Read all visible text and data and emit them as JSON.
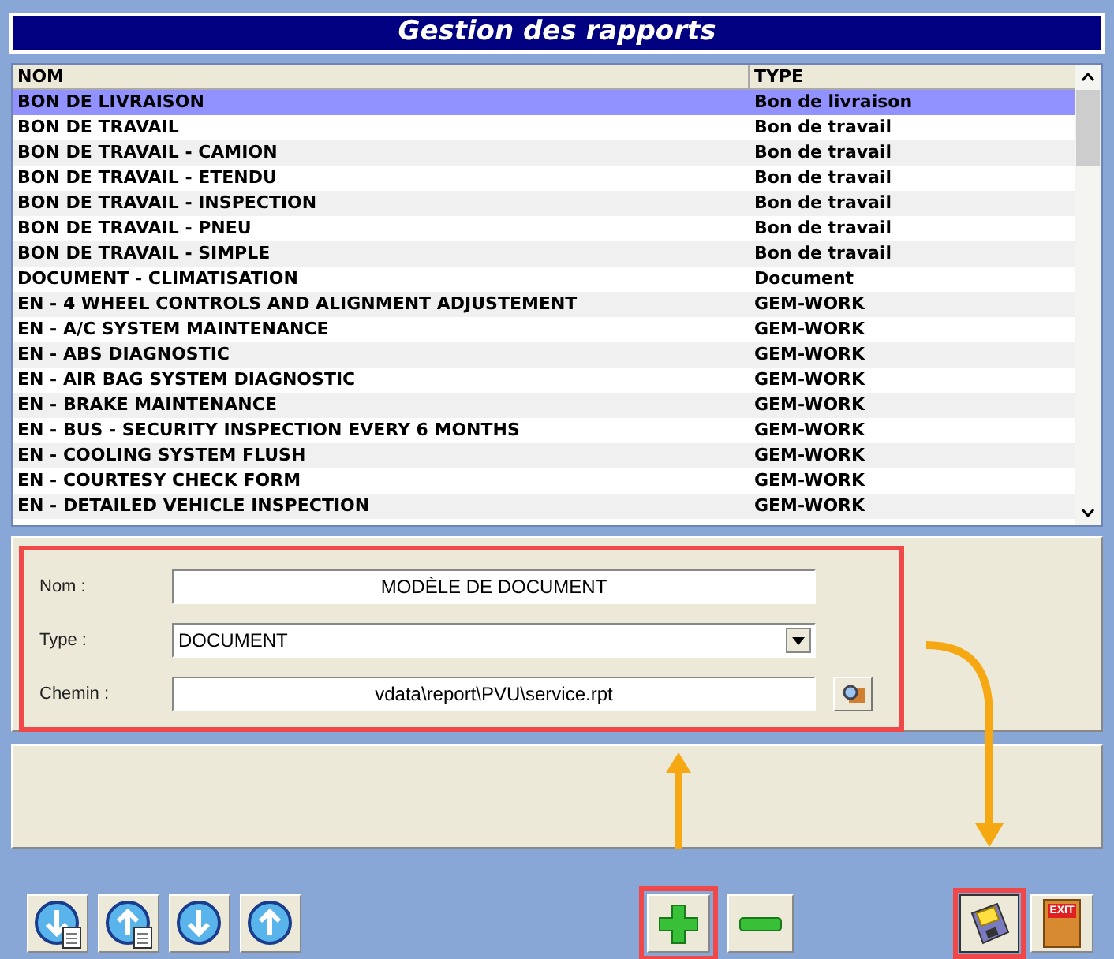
{
  "title": "Gestion des rapports",
  "table": {
    "columns": [
      "NOM",
      "TYPE"
    ],
    "rows": [
      {
        "nom": "BON DE LIVRAISON",
        "type": "Bon de livraison",
        "selected": true
      },
      {
        "nom": "BON DE TRAVAIL",
        "type": "Bon de travail",
        "selected": false
      },
      {
        "nom": "BON DE TRAVAIL - CAMION",
        "type": "Bon de travail",
        "selected": false
      },
      {
        "nom": "BON DE TRAVAIL - ETENDU",
        "type": "Bon de travail",
        "selected": false
      },
      {
        "nom": "BON DE TRAVAIL - INSPECTION",
        "type": "Bon de travail",
        "selected": false
      },
      {
        "nom": "BON DE TRAVAIL - PNEU",
        "type": "Bon de travail",
        "selected": false
      },
      {
        "nom": "BON DE TRAVAIL - SIMPLE",
        "type": "Bon de travail",
        "selected": false
      },
      {
        "nom": "DOCUMENT - CLIMATISATION",
        "type": "Document",
        "selected": false
      },
      {
        "nom": "EN - 4 WHEEL CONTROLS AND ALIGNMENT ADJUSTEMENT",
        "type": "GEM-WORK",
        "selected": false
      },
      {
        "nom": "EN - A/C SYSTEM MAINTENANCE",
        "type": "GEM-WORK",
        "selected": false
      },
      {
        "nom": "EN - ABS DIAGNOSTIC",
        "type": "GEM-WORK",
        "selected": false
      },
      {
        "nom": "EN - AIR BAG SYSTEM DIAGNOSTIC",
        "type": "GEM-WORK",
        "selected": false
      },
      {
        "nom": "EN - BRAKE MAINTENANCE",
        "type": "GEM-WORK",
        "selected": false
      },
      {
        "nom": "EN - BUS - SECURITY INSPECTION EVERY 6 MONTHS",
        "type": "GEM-WORK",
        "selected": false
      },
      {
        "nom": "EN - COOLING SYSTEM FLUSH",
        "type": "GEM-WORK",
        "selected": false
      },
      {
        "nom": "EN - COURTESY CHECK FORM",
        "type": "GEM-WORK",
        "selected": false
      },
      {
        "nom": "EN - DETAILED VEHICLE INSPECTION",
        "type": "GEM-WORK",
        "selected": false
      }
    ]
  },
  "form": {
    "fields": [
      {
        "label": "Nom :",
        "value": "MODÈLE DE DOCUMENT",
        "kind": "text"
      },
      {
        "label": "Type :",
        "value": "DOCUMENT",
        "kind": "select"
      },
      {
        "label": "Chemin :",
        "value": "vdata\\report\\PVU\\service.rpt",
        "kind": "path"
      }
    ]
  },
  "exit_label": "EXIT"
}
